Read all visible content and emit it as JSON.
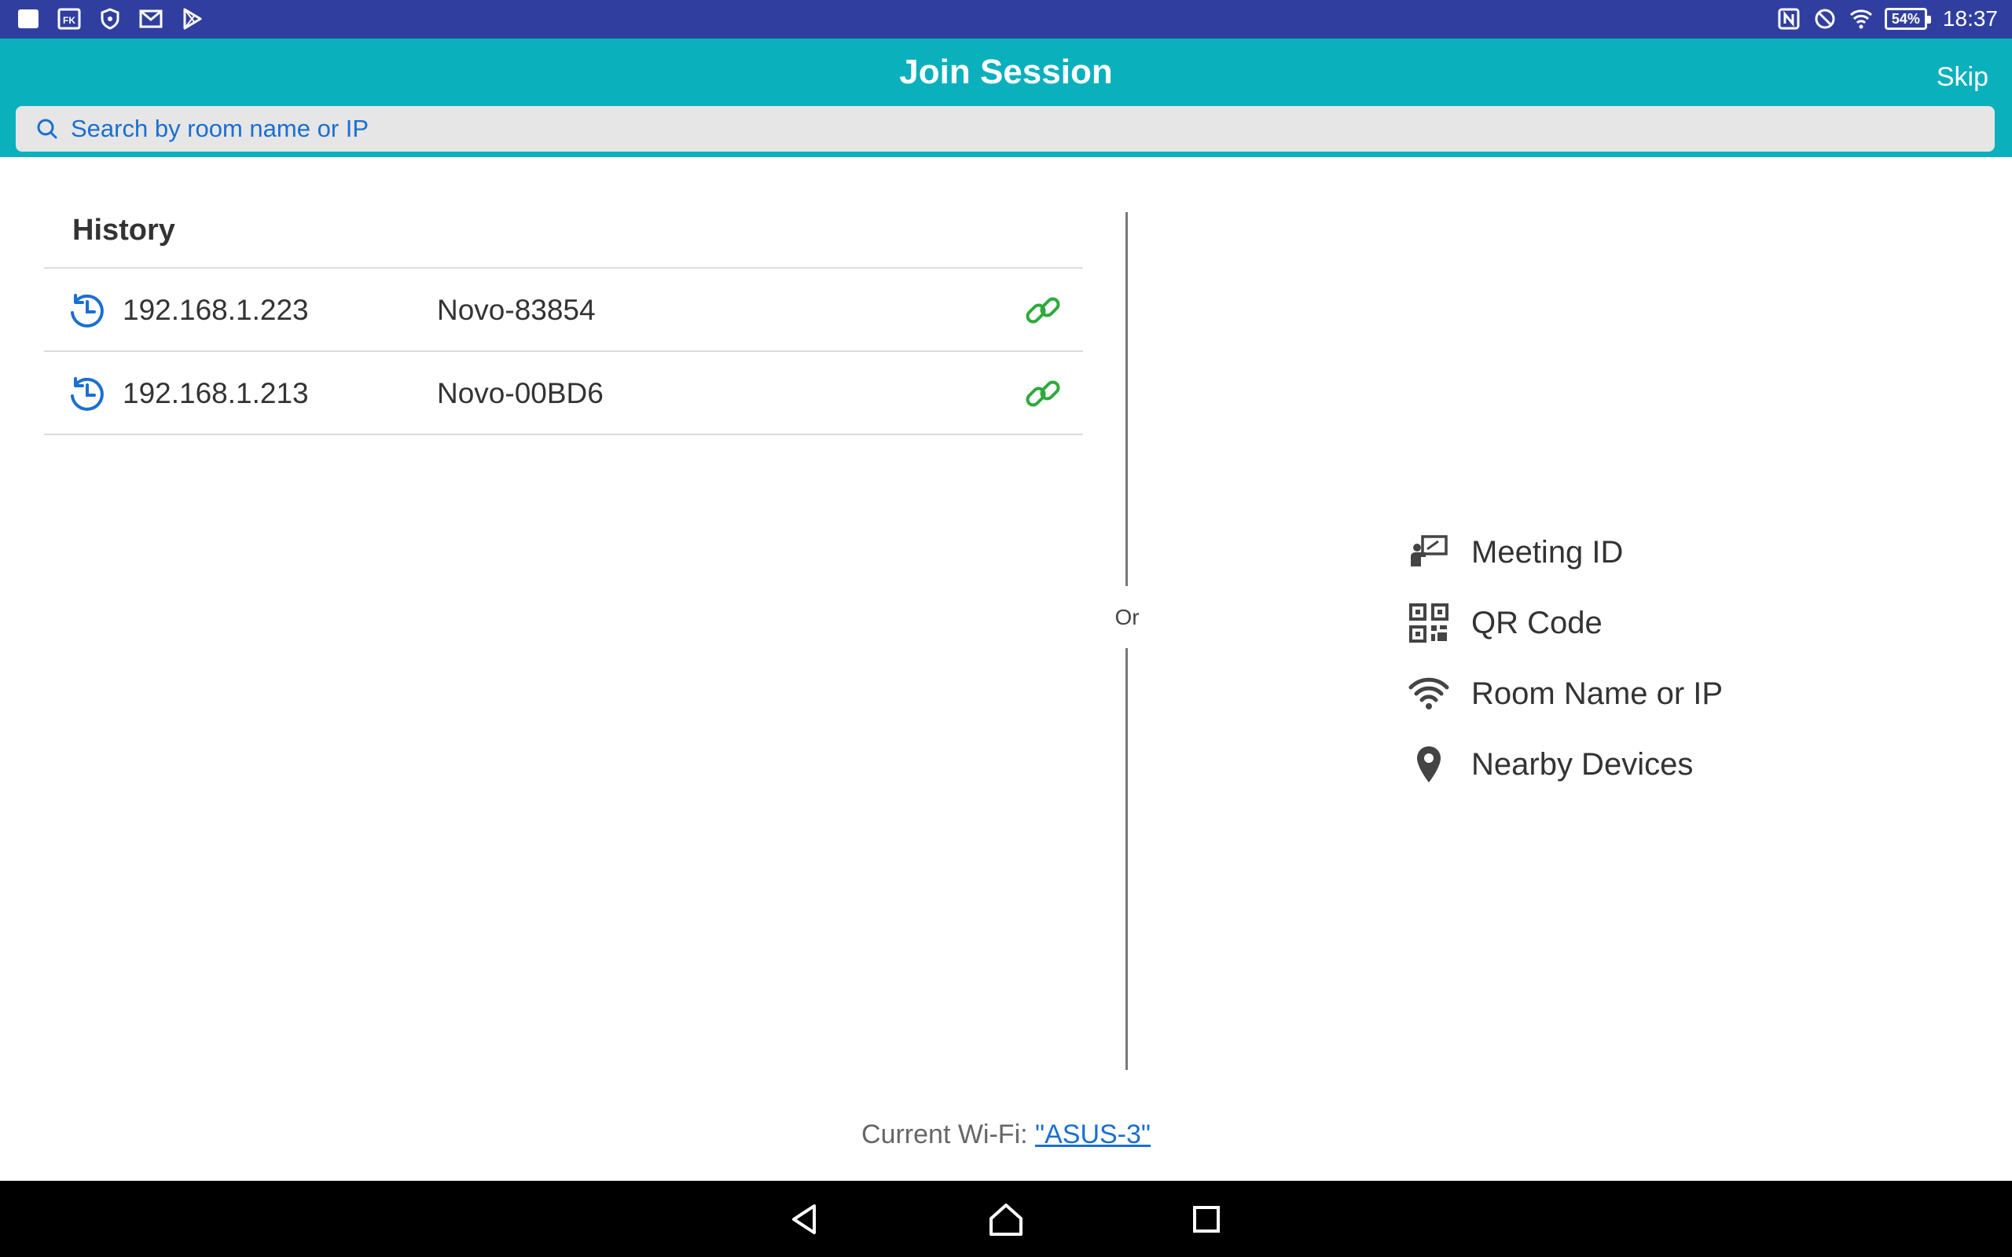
{
  "status_bar": {
    "left_icons": [
      "notification-app-icon",
      "fk-app-icon",
      "shield-app-icon",
      "gmail-icon",
      "play-store-icon"
    ],
    "right_icons": [
      "nfc-icon",
      "do-not-disturb-icon",
      "wifi-signal-icon"
    ],
    "battery": "54%",
    "time": "18:37"
  },
  "header": {
    "title": "Join Session",
    "skip_label": "Skip",
    "search_placeholder": "Search by room name or IP"
  },
  "history": {
    "title": "History",
    "items": [
      {
        "ip": "192.168.1.223",
        "name": "Novo-83854"
      },
      {
        "ip": "192.168.1.213",
        "name": "Novo-00BD6"
      }
    ]
  },
  "divider_label": "Or",
  "options": [
    {
      "icon": "presenter-icon",
      "label": "Meeting ID"
    },
    {
      "icon": "qr-code-icon",
      "label": "QR Code"
    },
    {
      "icon": "wifi-icon",
      "label": "Room Name or IP"
    },
    {
      "icon": "location-pin-icon",
      "label": "Nearby Devices"
    }
  ],
  "footer": {
    "wifi_prefix": "Current Wi-Fi: ",
    "wifi_name": "\"ASUS-3\""
  },
  "colors": {
    "status_bar": "#303f9f",
    "app_bar": "#0bb0bd",
    "accent_blue": "#1a6fd1",
    "link_green": "#2eaa3c",
    "text_dark": "#333333"
  }
}
